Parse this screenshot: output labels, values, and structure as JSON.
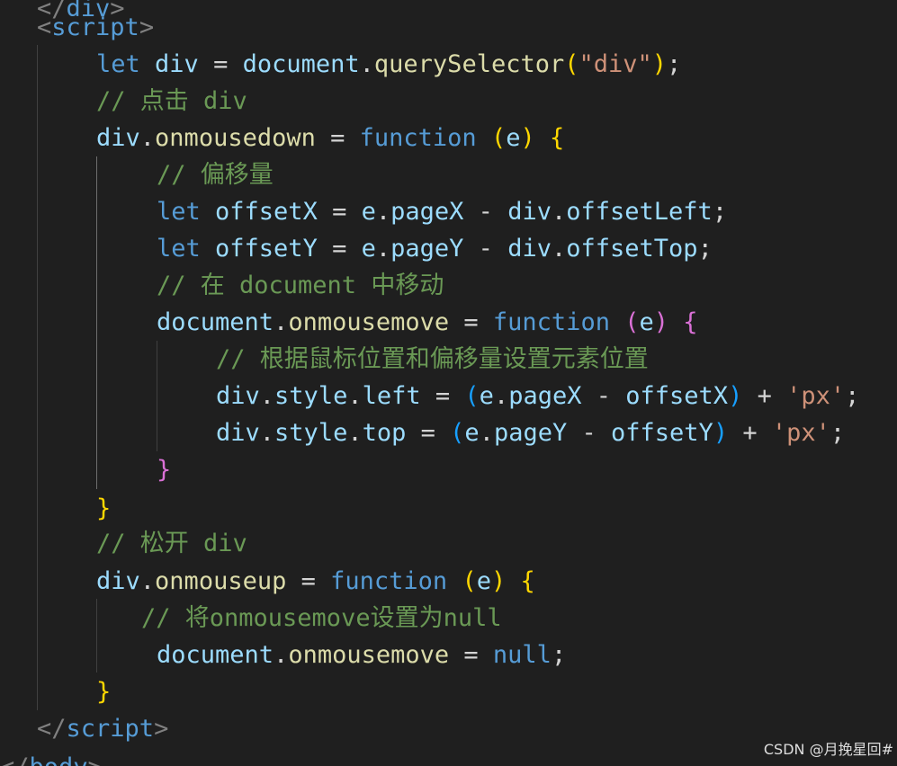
{
  "editor": {
    "theme_colors": {
      "background": "#1f1f1f",
      "keyword": "#569cd6",
      "variable": "#9cdcfe",
      "function": "#dcdcaa",
      "string": "#ce9178",
      "comment": "#6a9955",
      "tag_bracket": "#808080",
      "bracket_level1": "#ffd700",
      "bracket_level2": "#da70d6",
      "bracket_level3": "#179fff"
    },
    "lines": [
      [
        {
          "t": "</",
          "c": "tag"
        },
        {
          "t": "div",
          "c": "tagname"
        },
        {
          "t": ">",
          "c": "tag"
        }
      ],
      [
        {
          "t": "<",
          "c": "tag"
        },
        {
          "t": "script",
          "c": "tagname"
        },
        {
          "t": ">",
          "c": "tag"
        }
      ],
      [
        {
          "t": "let ",
          "c": "kw"
        },
        {
          "t": "div",
          "c": "var"
        },
        {
          "t": " = ",
          "c": "op"
        },
        {
          "t": "document",
          "c": "var"
        },
        {
          "t": ".",
          "c": "op"
        },
        {
          "t": "querySelector",
          "c": "fn"
        },
        {
          "t": "(",
          "c": "b1"
        },
        {
          "t": "\"div\"",
          "c": "str"
        },
        {
          "t": ")",
          "c": "b1"
        },
        {
          "t": ";",
          "c": "op"
        }
      ],
      [
        {
          "t": "// 点击 div",
          "c": "cm"
        }
      ],
      [
        {
          "t": "div",
          "c": "var"
        },
        {
          "t": ".",
          "c": "op"
        },
        {
          "t": "onmousedown",
          "c": "fn"
        },
        {
          "t": " = ",
          "c": "op"
        },
        {
          "t": "function",
          "c": "kw"
        },
        {
          "t": " ",
          "c": "op"
        },
        {
          "t": "(",
          "c": "b1"
        },
        {
          "t": "e",
          "c": "var"
        },
        {
          "t": ")",
          "c": "b1"
        },
        {
          "t": " ",
          "c": "op"
        },
        {
          "t": "{",
          "c": "b1"
        }
      ],
      [
        {
          "t": "// 偏移量",
          "c": "cm"
        }
      ],
      [
        {
          "t": "let ",
          "c": "kw"
        },
        {
          "t": "offsetX",
          "c": "var"
        },
        {
          "t": " = ",
          "c": "op"
        },
        {
          "t": "e",
          "c": "var"
        },
        {
          "t": ".",
          "c": "op"
        },
        {
          "t": "pageX",
          "c": "var"
        },
        {
          "t": " - ",
          "c": "op"
        },
        {
          "t": "div",
          "c": "var"
        },
        {
          "t": ".",
          "c": "op"
        },
        {
          "t": "offsetLeft",
          "c": "var"
        },
        {
          "t": ";",
          "c": "op"
        }
      ],
      [
        {
          "t": "let ",
          "c": "kw"
        },
        {
          "t": "offsetY",
          "c": "var"
        },
        {
          "t": " = ",
          "c": "op"
        },
        {
          "t": "e",
          "c": "var"
        },
        {
          "t": ".",
          "c": "op"
        },
        {
          "t": "pageY",
          "c": "var"
        },
        {
          "t": " - ",
          "c": "op"
        },
        {
          "t": "div",
          "c": "var"
        },
        {
          "t": ".",
          "c": "op"
        },
        {
          "t": "offsetTop",
          "c": "var"
        },
        {
          "t": ";",
          "c": "op"
        }
      ],
      [
        {
          "t": "// 在 document 中移动",
          "c": "cm"
        }
      ],
      [
        {
          "t": "document",
          "c": "var"
        },
        {
          "t": ".",
          "c": "op"
        },
        {
          "t": "onmousemove",
          "c": "fn"
        },
        {
          "t": " = ",
          "c": "op"
        },
        {
          "t": "function",
          "c": "kw"
        },
        {
          "t": " ",
          "c": "op"
        },
        {
          "t": "(",
          "c": "b2"
        },
        {
          "t": "e",
          "c": "var"
        },
        {
          "t": ")",
          "c": "b2"
        },
        {
          "t": " ",
          "c": "op"
        },
        {
          "t": "{",
          "c": "b2"
        }
      ],
      [
        {
          "t": "// 根据鼠标位置和偏移量设置元素位置",
          "c": "cm"
        }
      ],
      [
        {
          "t": "div",
          "c": "var"
        },
        {
          "t": ".",
          "c": "op"
        },
        {
          "t": "style",
          "c": "var"
        },
        {
          "t": ".",
          "c": "op"
        },
        {
          "t": "left",
          "c": "var"
        },
        {
          "t": " = ",
          "c": "op"
        },
        {
          "t": "(",
          "c": "b3"
        },
        {
          "t": "e",
          "c": "var"
        },
        {
          "t": ".",
          "c": "op"
        },
        {
          "t": "pageX",
          "c": "var"
        },
        {
          "t": " - ",
          "c": "op"
        },
        {
          "t": "offsetX",
          "c": "var"
        },
        {
          "t": ")",
          "c": "b3"
        },
        {
          "t": " + ",
          "c": "op"
        },
        {
          "t": "'px'",
          "c": "str"
        },
        {
          "t": ";",
          "c": "op"
        }
      ],
      [
        {
          "t": "div",
          "c": "var"
        },
        {
          "t": ".",
          "c": "op"
        },
        {
          "t": "style",
          "c": "var"
        },
        {
          "t": ".",
          "c": "op"
        },
        {
          "t": "top",
          "c": "var"
        },
        {
          "t": " = ",
          "c": "op"
        },
        {
          "t": "(",
          "c": "b3"
        },
        {
          "t": "e",
          "c": "var"
        },
        {
          "t": ".",
          "c": "op"
        },
        {
          "t": "pageY",
          "c": "var"
        },
        {
          "t": " - ",
          "c": "op"
        },
        {
          "t": "offsetY",
          "c": "var"
        },
        {
          "t": ")",
          "c": "b3"
        },
        {
          "t": " + ",
          "c": "op"
        },
        {
          "t": "'px'",
          "c": "str"
        },
        {
          "t": ";",
          "c": "op"
        }
      ],
      [
        {
          "t": "}",
          "c": "b2"
        }
      ],
      [
        {
          "t": "}",
          "c": "b1"
        }
      ],
      [
        {
          "t": "// 松开 div",
          "c": "cm"
        }
      ],
      [
        {
          "t": "div",
          "c": "var"
        },
        {
          "t": ".",
          "c": "op"
        },
        {
          "t": "onmouseup",
          "c": "fn"
        },
        {
          "t": " = ",
          "c": "op"
        },
        {
          "t": "function",
          "c": "kw"
        },
        {
          "t": " ",
          "c": "op"
        },
        {
          "t": "(",
          "c": "b1"
        },
        {
          "t": "e",
          "c": "var"
        },
        {
          "t": ")",
          "c": "b1"
        },
        {
          "t": " ",
          "c": "op"
        },
        {
          "t": "{",
          "c": "b1"
        }
      ],
      [
        {
          "t": "// 将onmousemove设置为null",
          "c": "cm"
        }
      ],
      [
        {
          "t": "document",
          "c": "var"
        },
        {
          "t": ".",
          "c": "op"
        },
        {
          "t": "onmousemove",
          "c": "fn"
        },
        {
          "t": " = ",
          "c": "op"
        },
        {
          "t": "null",
          "c": "kw"
        },
        {
          "t": ";",
          "c": "op"
        }
      ],
      [
        {
          "t": "}",
          "c": "b1"
        }
      ],
      [
        {
          "t": "</",
          "c": "tag"
        },
        {
          "t": "script",
          "c": "tagname"
        },
        {
          "t": ">",
          "c": "tag"
        }
      ],
      [
        {
          "t": "</",
          "c": "tag"
        },
        {
          "t": "body",
          "c": "tagname"
        },
        {
          "t": ">",
          "c": "tag"
        }
      ]
    ]
  },
  "watermark": "CSDN @月挽星回#"
}
